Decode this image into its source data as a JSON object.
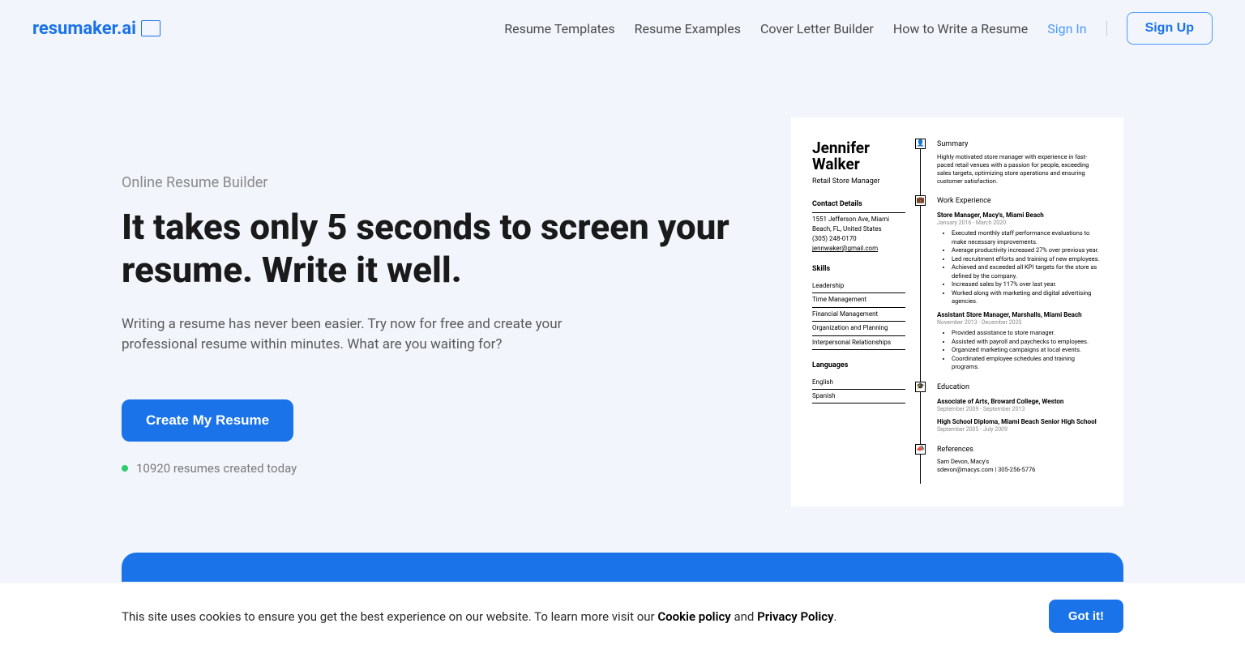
{
  "brand": "resumaker.ai",
  "nav": {
    "items": [
      "Resume Templates",
      "Resume Examples",
      "Cover Letter Builder",
      "How to Write a Resume"
    ],
    "signin": "Sign In",
    "signup": "Sign Up"
  },
  "hero": {
    "eyebrow": "Online Resume Builder",
    "headline": "It takes only 5 seconds to screen your resume. Write it well.",
    "subtext": "Writing a resume has never been easier. Try now for free and create your professional resume within minutes. What are you waiting for?",
    "cta": "Create My Resume",
    "stats": "10920 resumes created today"
  },
  "resume": {
    "name": "Jennifer Walker",
    "role": "Retail Store Manager",
    "contact_heading": "Contact Details",
    "contact": {
      "address": "1551 Jefferson Ave, Miami Beach, FL, United States",
      "phone": "(305) 248-0170",
      "email": "jennwaker@gmail.com"
    },
    "skills_heading": "Skills",
    "skills": [
      "Leadership",
      "Time Management",
      "Financial Management",
      "Organization and Planning",
      "Interpersonal Relationships"
    ],
    "languages_heading": "Languages",
    "languages": [
      "English",
      "Spanish"
    ],
    "summary_heading": "Summary",
    "summary": "Highly motivated store manager with experience in fast-paced retail venues with a passion for people, exceeding sales targets, optimizing store operations and ensuring customer satisfaction.",
    "work_heading": "Work Experience",
    "jobs": [
      {
        "title": "Store Manager, Macy's, Miami Beach",
        "date": "January 2016 - March 2020",
        "bullets": [
          "Executed monthly staff performance evaluations to make necessary improvements.",
          "Average productivity increased 27% over previous year.",
          "Led recruitment efforts and training of new employees.",
          "Achieved and exceeded all KPI targets for the store as defined by the company.",
          "Increased sales by 117% over last year.",
          "Worked along with marketing and digital advertising agencies."
        ]
      },
      {
        "title": "Assistant Store Manager, Marshalls, Miami Beach",
        "date": "November 2013 - December 2020",
        "bullets": [
          "Provided assistance to store manager.",
          "Assisted with payroll and paychecks to employees.",
          "Organized marketing campaigns at local events.",
          "Coordinated employee schedules and training programs."
        ]
      }
    ],
    "education_heading": "Education",
    "education": [
      {
        "title": "Associate of Arts, Broward College, Weston",
        "date": "September 2009 - September 2013"
      },
      {
        "title": "High School Diploma, Miami Beach Senior High School",
        "date": "September 2005 - July 2009"
      }
    ],
    "references_heading": "References",
    "references": {
      "name": "Sam Devon, Macy's",
      "contact": "sdevon@macys.com | 305-256-5776"
    }
  },
  "cookie": {
    "text_pre": "This site uses cookies to ensure you get the best experience on our website. To learn more visit our ",
    "cookie_policy": "Cookie policy",
    "and": " and ",
    "privacy_policy": "Privacy Policy",
    "dot": ".",
    "button": "Got it!"
  }
}
